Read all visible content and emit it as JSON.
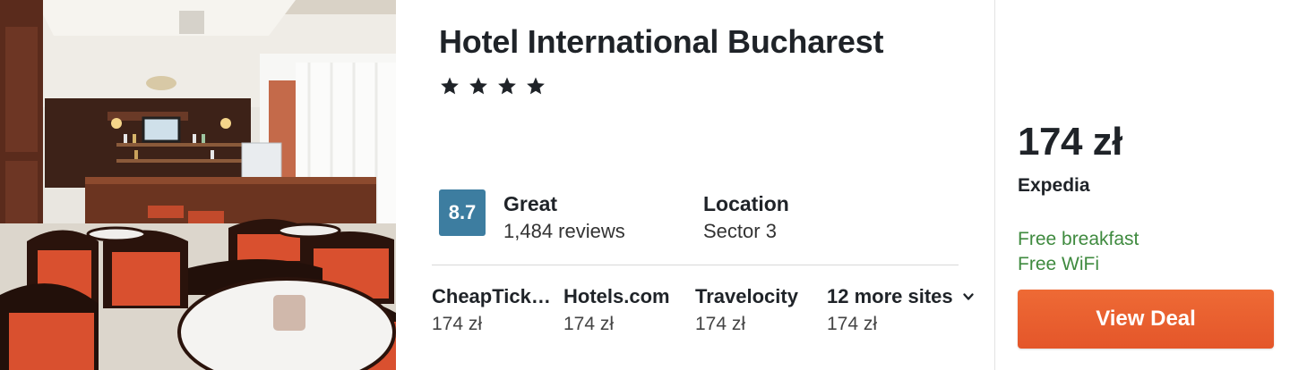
{
  "hotel": {
    "name": "Hotel International Bucharest",
    "stars": 4,
    "rating": {
      "score": "8.7",
      "label": "Great",
      "reviews": "1,484 reviews"
    },
    "location": {
      "label": "Location",
      "value": "Sector 3"
    }
  },
  "sites": [
    {
      "name": "CheapTickets",
      "price": "174 zł"
    },
    {
      "name": "Hotels.com",
      "price": "174 zł"
    },
    {
      "name": "Travelocity",
      "price": "174 zł"
    },
    {
      "name": "12 more sites",
      "price": "174 zł"
    }
  ],
  "deal": {
    "price": "174 zł",
    "provider": "Expedia",
    "amenities": [
      "Free breakfast",
      "Free WiFi"
    ],
    "button_label": "View Deal"
  },
  "icons": {
    "star": "star-icon",
    "more": "chevron-down-icon"
  },
  "colors": {
    "rating_badge": "#3d7da0",
    "amenity": "#3f8a3f",
    "button": "#e95f2f"
  }
}
